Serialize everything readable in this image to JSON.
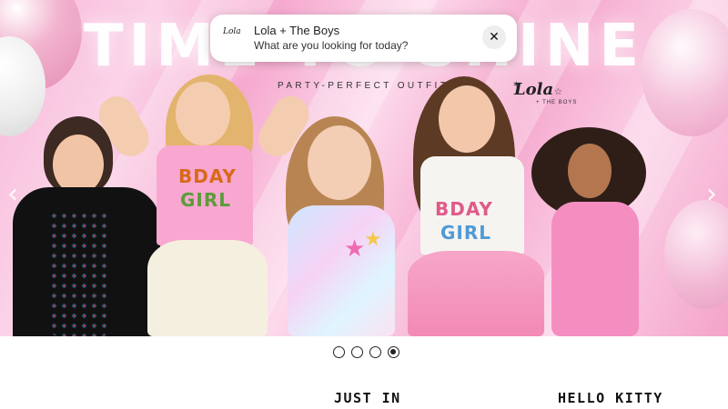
{
  "hero": {
    "headline": "TIME TO SHINE",
    "subline": "PARTY-PERFECT OUTFITS",
    "logo_text": "Lola",
    "logo_sub": "+ THE BOYS",
    "shirt_text_line1": "BDAY",
    "shirt_text_line2": "GIRL",
    "prev_icon": "chevron-left-icon",
    "next_icon": "chevron-right-icon"
  },
  "toast": {
    "logo_text": "Lola",
    "title": "Lola + The Boys",
    "subtitle": "What are you looking for today?",
    "close_icon": "close-icon",
    "close_glyph": "✕"
  },
  "carousel": {
    "slide_count": 4,
    "active_index": 3
  },
  "sections": {
    "just_in": "JUST IN",
    "hello_kitty": "HELLO KITTY"
  },
  "colors": {
    "hero_pink": "#f6a9cf",
    "text_dark": "#111111"
  }
}
